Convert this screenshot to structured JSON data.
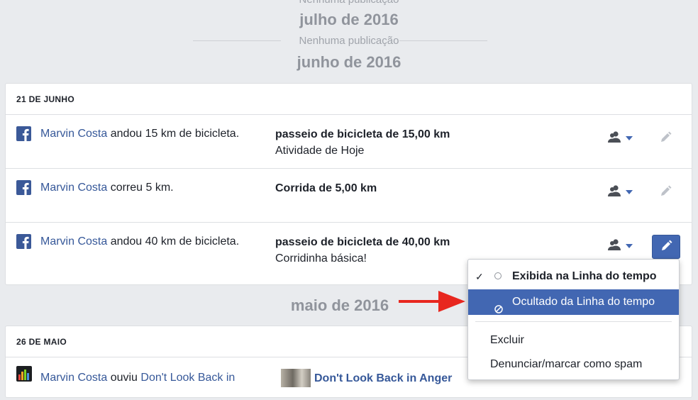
{
  "timeline": {
    "top_fragment": "Nenhuma publicação",
    "july": {
      "heading": "julho de 2016",
      "empty_text": "Nenhuma publicação"
    },
    "june": {
      "heading": "junho de 2016"
    },
    "may": {
      "heading": "maio de 2016"
    }
  },
  "june_card": {
    "date_header": "21 DE JUNHO",
    "rows": [
      {
        "icon": "facebook-icon",
        "name": "Marvin Costa",
        "action": " andou 15 km de bicicleta.",
        "detail_title": "passeio de bicicleta de 15,00 km",
        "detail_sub": "Atividade de Hoje"
      },
      {
        "icon": "facebook-icon",
        "name": "Marvin Costa",
        "action": " correu 5 km.",
        "detail_title": "Corrida de 5,00 km",
        "detail_sub": ""
      },
      {
        "icon": "facebook-icon",
        "name": "Marvin Costa",
        "action": " andou 40 km de bicicleta.",
        "detail_title": "passeio de bicicleta de 40,00 km",
        "detail_sub": "Corridinha básica!"
      }
    ]
  },
  "may_card": {
    "date_header": "26 DE MAIO",
    "rows": [
      {
        "icon": "music-app-icon",
        "name": "Marvin Costa",
        "action": " ouviu ",
        "song_link": "Don't Look Back in",
        "detail_title": "Don't Look Back in Anger"
      }
    ]
  },
  "dropdown_menu": {
    "items": [
      {
        "label": "Exibida na Linha do tempo",
        "checked": true
      },
      {
        "label": "Ocultado da Linha do tempo",
        "highlighted": true
      },
      {
        "label": "Excluir"
      },
      {
        "label": "Denunciar/marcar como spam"
      }
    ]
  },
  "colors": {
    "background": "#e9ebee",
    "link": "#365899",
    "facebook_blue": "#3b5998",
    "highlight": "#4267b2",
    "arrow": "#e8271f",
    "muted_heading": "#90949c"
  }
}
